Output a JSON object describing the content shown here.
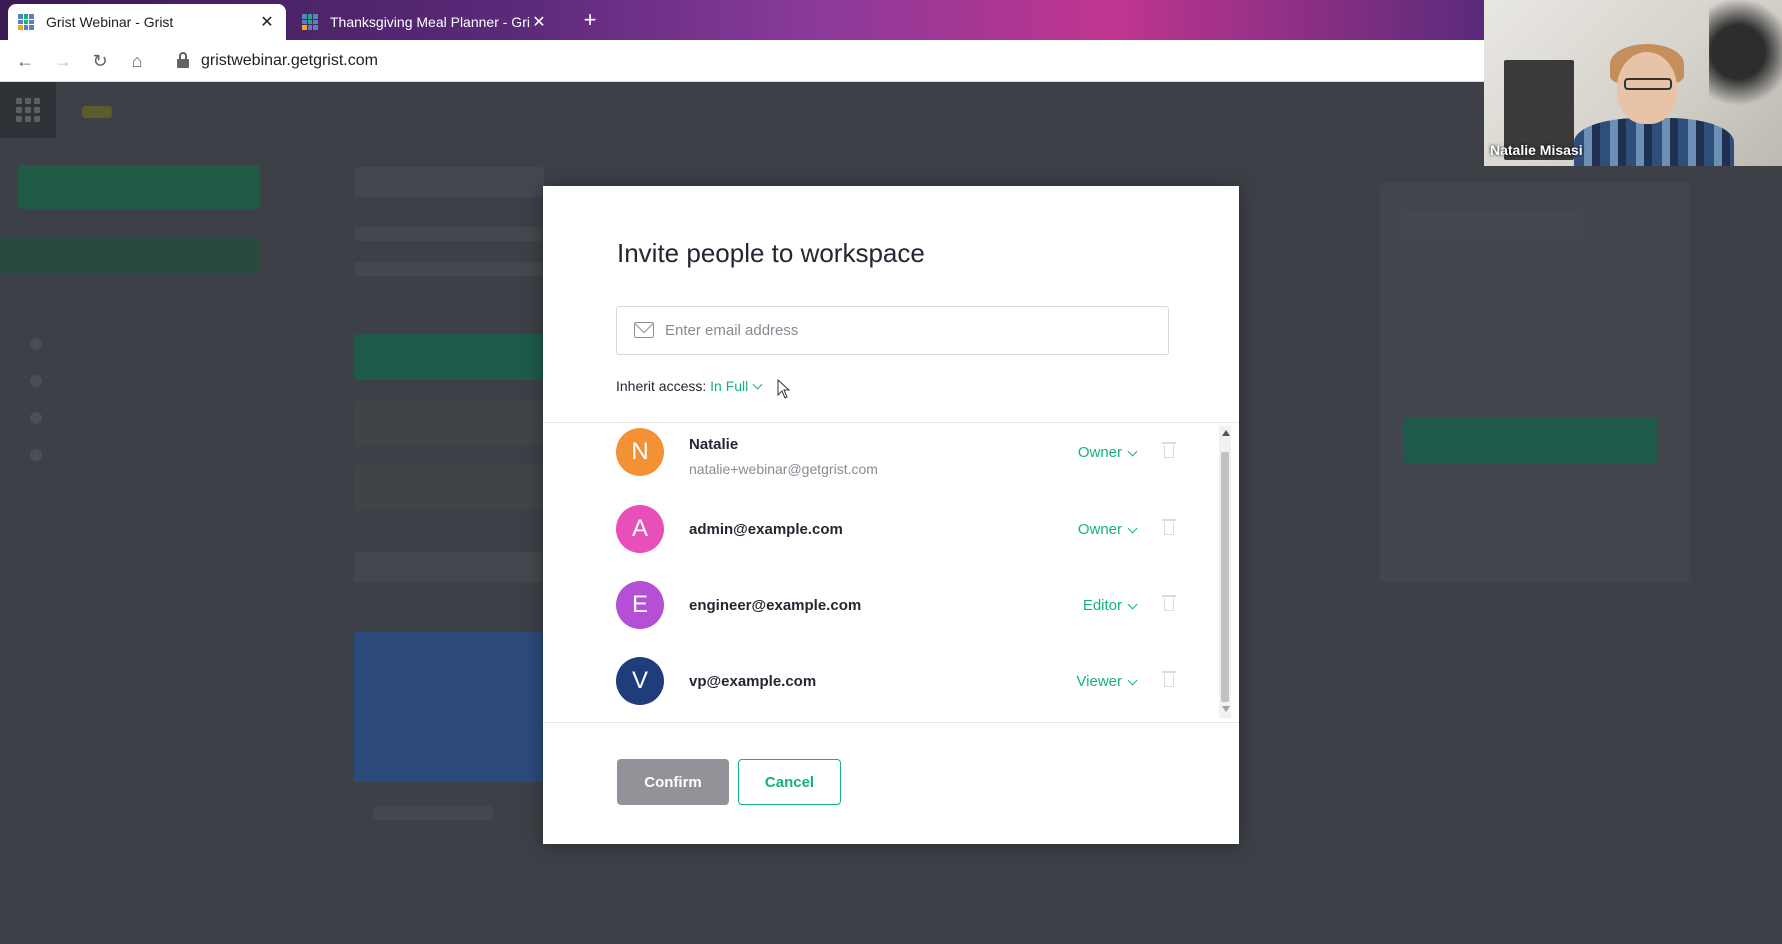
{
  "browser": {
    "tabs": [
      {
        "title": "Grist Webinar - Grist",
        "close": "✕"
      },
      {
        "title": "Thanksgiving Meal Planner - Grist",
        "close": "✕"
      }
    ],
    "new_tab": "+",
    "url": "gristwebinar.getgrist.com"
  },
  "webcam": {
    "name": "Natalie Misasi"
  },
  "modal": {
    "title": "Invite people to workspace",
    "email_placeholder": "Enter email address",
    "inherit_label": "Inherit access: ",
    "inherit_value": "In Full",
    "members": [
      {
        "initial": "N",
        "name": "Natalie",
        "email": "natalie+webinar@getgrist.com",
        "role": "Owner",
        "color": "#f39235"
      },
      {
        "initial": "A",
        "email": "admin@example.com",
        "role": "Owner",
        "color": "#e84fb9"
      },
      {
        "initial": "E",
        "email": "engineer@example.com",
        "role": "Editor",
        "color": "#b44fd6"
      },
      {
        "initial": "V",
        "email": "vp@example.com",
        "role": "Viewer",
        "color": "#1f3d7a"
      }
    ],
    "confirm_label": "Confirm",
    "cancel_label": "Cancel"
  },
  "colors": {
    "accent": "#16b378",
    "disabled_button": "#929299"
  }
}
